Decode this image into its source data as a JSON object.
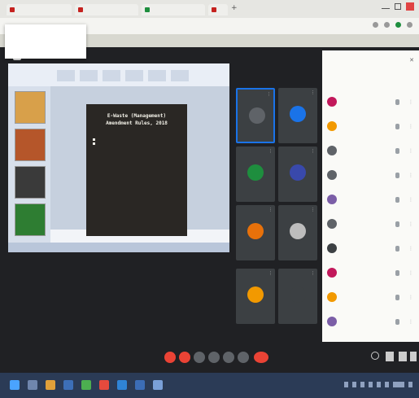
{
  "browser": {
    "tabs": [
      {
        "label": "",
        "color": "#c5221f"
      },
      {
        "label": "",
        "color": "#c5221f"
      },
      {
        "label": "",
        "color": "#1e8e3e"
      },
      {
        "label": "",
        "color": "#c5221f"
      }
    ],
    "new_tab_label": "+",
    "url": "",
    "account_popup": {
      "line1": "",
      "line2": "",
      "line3": ""
    }
  },
  "slide": {
    "title_line1": "E-Waste (Management)",
    "title_line2": "Amendment Rules, 2018",
    "bullets": [
      "",
      "",
      "",
      "",
      "",
      "",
      ""
    ]
  },
  "tiles": [
    {
      "name": "",
      "avatar_color": "#5f6368",
      "highlight": true
    },
    {
      "name": "",
      "avatar_color": "#1a73e8",
      "highlight": false
    },
    {
      "name": "",
      "avatar_color": "#1e8e3e",
      "highlight": false
    },
    {
      "name": "",
      "avatar_color": "#3949ab",
      "highlight": false
    },
    {
      "name": "",
      "avatar_color": "#e8710a",
      "highlight": false
    },
    {
      "name": "",
      "avatar_color": "#bdbdbd",
      "highlight": false
    },
    {
      "name": "",
      "avatar_color": "#f29900",
      "highlight": false
    },
    {
      "name": "",
      "avatar_color": "#3c4043",
      "highlight": false
    }
  ],
  "people_panel": {
    "title": "",
    "close_icon": "close-icon",
    "search_hint": "",
    "participants": [
      {
        "name": "",
        "color": "#c2185b"
      },
      {
        "name": "",
        "color": "#f29900"
      },
      {
        "name": "",
        "color": "#5f6368"
      },
      {
        "name": "",
        "color": "#5f6368"
      },
      {
        "name": "",
        "color": "#7b5ea7"
      },
      {
        "name": "",
        "color": "#5f6368"
      },
      {
        "name": "",
        "color": "#3c4043"
      },
      {
        "name": "",
        "color": "#c2185b"
      },
      {
        "name": "",
        "color": "#f29900"
      },
      {
        "name": "",
        "color": "#7b5ea7"
      }
    ]
  },
  "bottom_bar": {
    "time_label": "",
    "controls": [
      {
        "icon": "mic-icon",
        "color": "#ea4335"
      },
      {
        "icon": "camera-icon",
        "color": "#ea4335"
      },
      {
        "icon": "captions-icon",
        "color": "#5f6368"
      },
      {
        "icon": "raise-hand-icon",
        "color": "#5f6368"
      },
      {
        "icon": "present-icon",
        "color": "#5f6368"
      },
      {
        "icon": "more-icon",
        "color": "#5f6368"
      },
      {
        "icon": "end-call-icon",
        "color": "#ea4335"
      }
    ]
  },
  "colors": {
    "meet_bg": "#202124",
    "taskbar": "#2b3b56",
    "accent_blue": "#1a73e8",
    "end_call_red": "#ea4335"
  }
}
